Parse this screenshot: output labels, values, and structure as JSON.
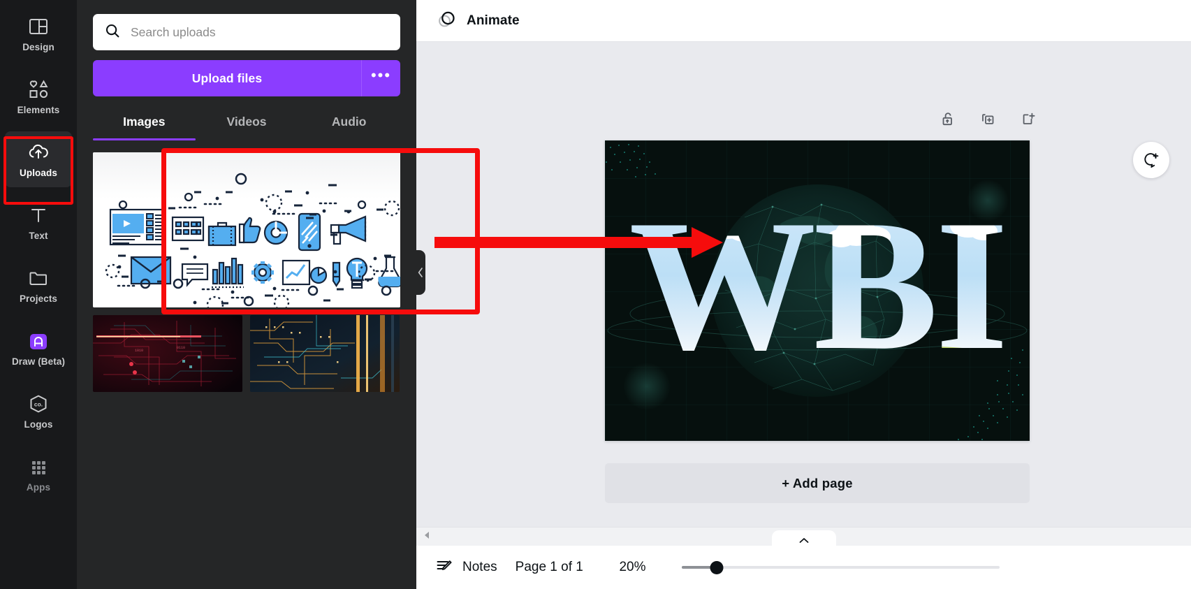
{
  "app": {
    "accent_purple": "#8b3dff",
    "highlight_red": "#f60c0c",
    "rail_bg": "#18191b",
    "panel_bg": "#252627",
    "canvas_bg": "#e9eaee"
  },
  "sidebar": {
    "items": [
      {
        "label": "Design",
        "icon": "layout-icon",
        "active": false
      },
      {
        "label": "Elements",
        "icon": "shapes-icon",
        "active": false
      },
      {
        "label": "Uploads",
        "icon": "cloud-upload-icon",
        "active": true
      },
      {
        "label": "Text",
        "icon": "text-t-icon",
        "active": false
      },
      {
        "label": "Projects",
        "icon": "folder-icon",
        "active": false
      },
      {
        "label": "Draw (Beta)",
        "icon": "draw-pen-icon",
        "active": false
      },
      {
        "label": "Logos",
        "icon": "logo-co-icon",
        "active": false
      },
      {
        "label": "Apps",
        "icon": "grid-apps-icon",
        "active": false
      }
    ]
  },
  "panel": {
    "search": {
      "placeholder": "Search uploads",
      "value": "",
      "icon": "search-icon"
    },
    "upload_button": "Upload files",
    "more_button": "•••",
    "tabs": [
      {
        "label": "Images",
        "active": true
      },
      {
        "label": "Videos",
        "active": false
      },
      {
        "label": "Audio",
        "active": false
      }
    ],
    "thumbnails": [
      {
        "name": "flat-design-icons-illustration",
        "selected": true
      },
      {
        "name": "red-circuit-board-abstract",
        "selected": false
      },
      {
        "name": "orange-circuit-board-abstract",
        "selected": false
      }
    ],
    "collapse_handle_icon": "chevron-left-icon"
  },
  "toolbar": {
    "animate_label": "Animate",
    "animate_icon": "animate-circles-icon",
    "page_tools": [
      {
        "name": "lock-icon",
        "label": "Lock"
      },
      {
        "name": "duplicate-page-icon",
        "label": "Duplicate page"
      },
      {
        "name": "add-page-icon",
        "label": "Add page"
      }
    ],
    "comment_icon": "comment-add-icon"
  },
  "canvas": {
    "design_text": "WBI",
    "design_background": "#06100e",
    "add_page_label": "+ Add page"
  },
  "bottombar": {
    "notes_label": "Notes",
    "notes_icon": "notes-pencil-icon",
    "page_indicator": "Page 1 of 1",
    "zoom_level": "20%",
    "collapse_icon": "chevron-up-icon",
    "scroll_left_icon": "caret-left-icon"
  },
  "annotations": {
    "arrow_color": "#f60c0c",
    "arrow_label": "drag-uploaded-image-to-canvas"
  }
}
